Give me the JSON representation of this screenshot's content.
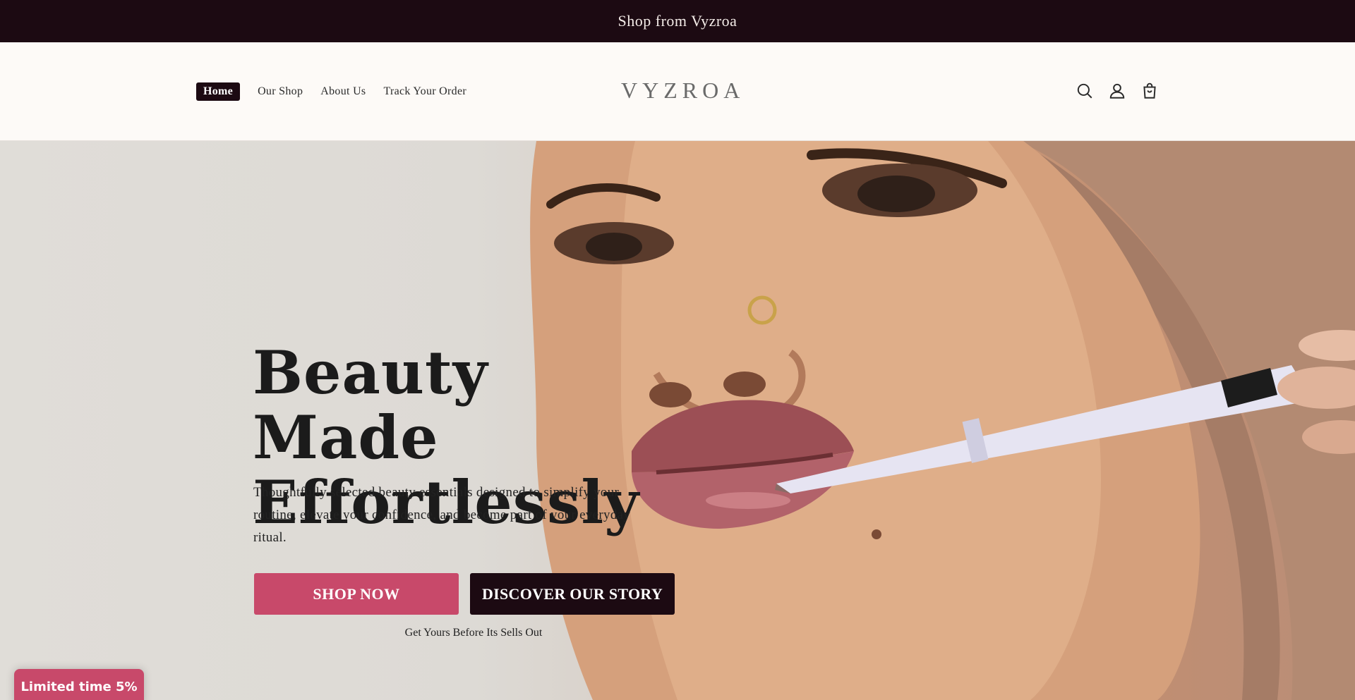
{
  "announcement": "Shop from Vyzroa",
  "nav": {
    "items": [
      {
        "label": "Home",
        "active": true
      },
      {
        "label": "Our Shop"
      },
      {
        "label": "About Us"
      },
      {
        "label": "Track Your Order"
      }
    ]
  },
  "logo": "VYZROA",
  "header_icons": [
    "search-icon",
    "account-icon",
    "cart-icon"
  ],
  "hero": {
    "title_line1": "Beauty Made",
    "title_line2": "Effortlessly",
    "subtitle": "Thoughtfully selected beauty essentials designed to simplify your routine, elevate your confidence, and become part of your everyday ritual.",
    "primary_cta": "SHOP NOW",
    "secondary_cta": "DISCOVER OUR STORY",
    "note": "Get Yours Before Its Sells Out"
  },
  "promo_tab": "Limited time 5%",
  "colors": {
    "dark": "#1c0a12",
    "accent_pink": "#c8496a",
    "header_bg": "#fdfaf7"
  }
}
